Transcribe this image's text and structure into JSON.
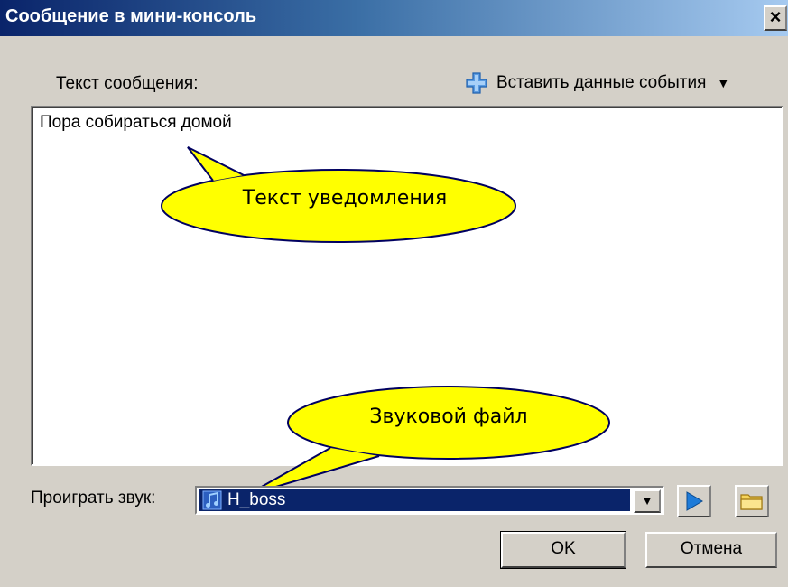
{
  "window": {
    "title": "Сообщение в мини-консоль",
    "close_label": "×"
  },
  "message": {
    "label": "Текст сообщения:",
    "insert_event_data_label": "Вставить данные события",
    "text": "Пора собираться домой"
  },
  "callouts": {
    "notification_text": "Текст уведомления",
    "sound_file": "Звуковой файл"
  },
  "sound": {
    "label": "Проиграть звук:",
    "selected": "H_boss",
    "select_arrow": "▼"
  },
  "buttons": {
    "ok": "OK",
    "cancel": "Отмена"
  },
  "colors": {
    "titlebar": "#0a246a",
    "dialog_bg": "#d4d0c8",
    "callout_fill": "#ffff00",
    "selection": "#0a246a",
    "play_icon": "#1e7bd8"
  }
}
